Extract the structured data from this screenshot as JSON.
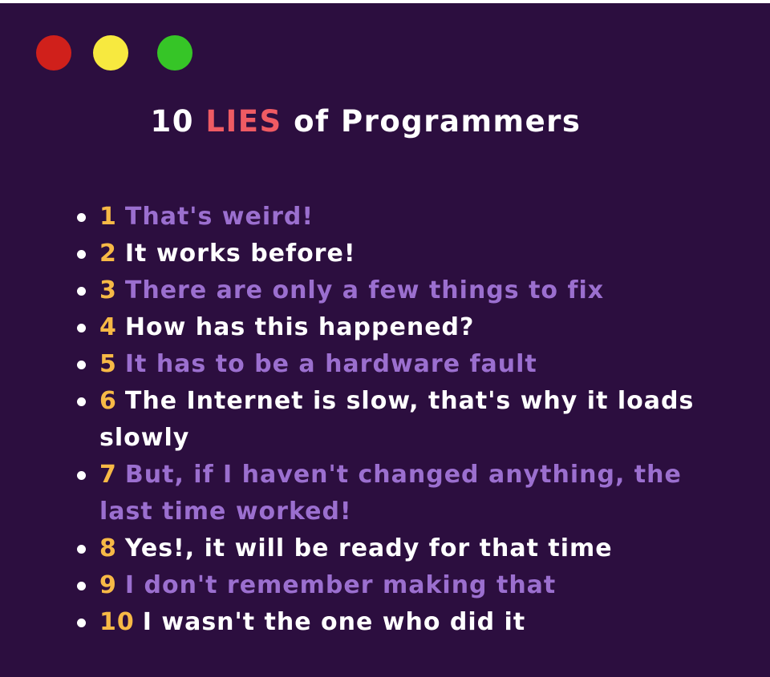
{
  "window_dots": {
    "red": "#d0201b",
    "yellow": "#f7e93f",
    "green": "#36c527"
  },
  "title": {
    "before": "10 ",
    "accent": "LIES",
    "after": " of Programmers"
  },
  "colors": {
    "background": "#2c0e3f",
    "number": "#f7b946",
    "accent": "#ef5b63",
    "purple_text": "#9b6fcf",
    "white_text": "#ffffff"
  },
  "items": [
    {
      "num": "1",
      "text": "That's weird!"
    },
    {
      "num": "2",
      "text": "It works before!"
    },
    {
      "num": "3",
      "text": "There are only a few things to fix"
    },
    {
      "num": "4",
      "text": "How has this happened?"
    },
    {
      "num": "5",
      "text": "It has to be a hardware fault"
    },
    {
      "num": "6",
      "text": "The Internet is slow, that's why it loads slowly"
    },
    {
      "num": "7",
      "text": "But, if I haven't changed anything, the last time worked!"
    },
    {
      "num": "8",
      "text": "Yes!, it will be ready for that time"
    },
    {
      "num": "9",
      "text": "I don't remember making that"
    },
    {
      "num": "10",
      "text": "I wasn't the one who did it"
    }
  ]
}
